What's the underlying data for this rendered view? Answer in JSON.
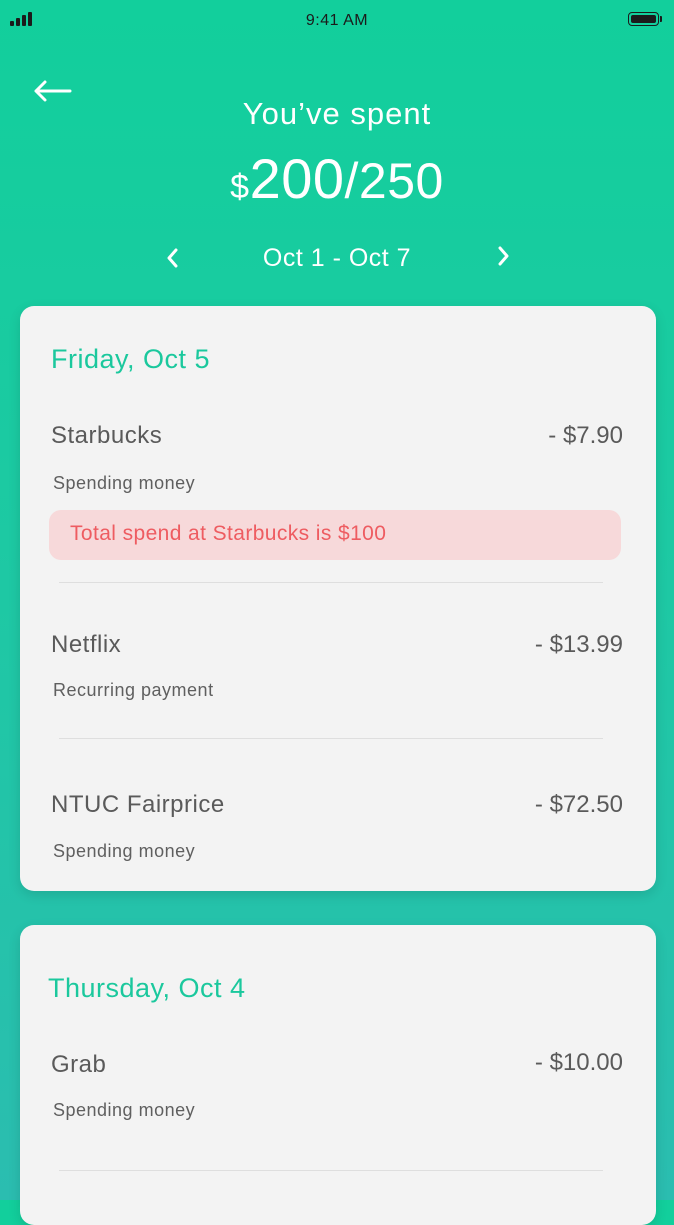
{
  "status_bar": {
    "time": "9:41 AM"
  },
  "header": {
    "title": "You’ve spent",
    "currency_symbol": "$",
    "spent": "200",
    "budget": "/250",
    "date_range": "Oct 1 - Oct 7"
  },
  "days": [
    {
      "title": "Friday, Oct 5",
      "transactions": [
        {
          "name": "Starbucks",
          "amount": "- $7.90",
          "category": "Spending money",
          "alert": "Total spend at Starbucks is $100"
        },
        {
          "name": "Netflix",
          "amount": "- $13.99",
          "category": "Recurring payment"
        },
        {
          "name": "NTUC Fairprice",
          "amount": "- $72.50",
          "category": "Spending money"
        }
      ]
    },
    {
      "title": "Thursday, Oct 4",
      "transactions": [
        {
          "name": "Grab",
          "amount": "- $10.00",
          "category": "Spending money"
        }
      ]
    }
  ],
  "colors": {
    "accent": "#1bc89d",
    "alert_text": "#ee5c61",
    "alert_bg": "#f7d9da"
  }
}
